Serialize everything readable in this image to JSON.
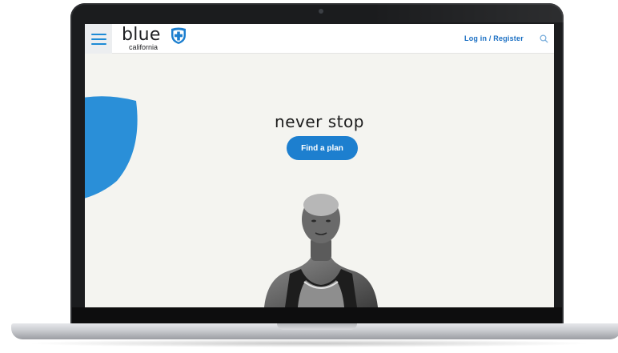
{
  "header": {
    "menu_icon": "hamburger-menu-icon",
    "logo": {
      "word": "blue",
      "sub": "california",
      "icon": "shield-cross-icon"
    },
    "login_label": "Log in / Register",
    "search_icon": "search-icon"
  },
  "hero": {
    "headline": "never stop",
    "cta_label": "Find a plan",
    "decor_icon": "shield-graphic"
  },
  "colors": {
    "brand_blue": "#1d7fcf",
    "link_blue": "#1a6fc3",
    "hero_bg": "#f4f4f0",
    "menu_bg": "#eceef0"
  }
}
